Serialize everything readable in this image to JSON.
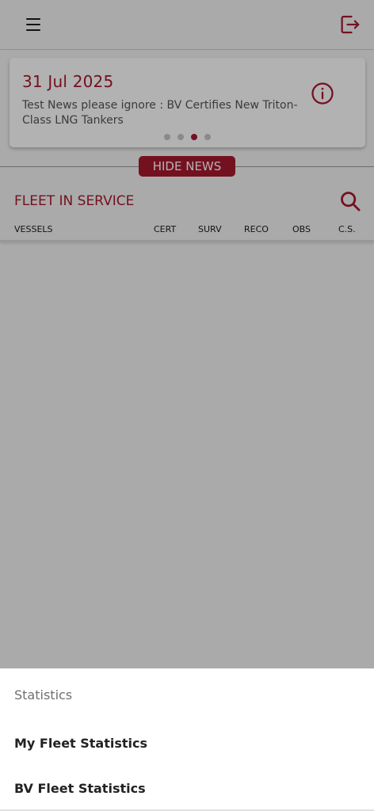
{
  "header": {
    "menu_icon": "hamburger-menu-icon",
    "logout_icon": "logout-icon"
  },
  "news": {
    "date": "31 Jul 2025",
    "text": "Test News please ignore : BV Certifies New Triton-Class LNG Tankers",
    "info_icon": "info-circle-icon",
    "pagination": {
      "total": 4,
      "active": 3
    },
    "hide_label": "HIDE NEWS"
  },
  "fleet": {
    "title": "FLEET IN SERVICE",
    "search_icon": "search-icon",
    "columns": [
      "VESSELS",
      "CERT",
      "SURV",
      "RECO",
      "OBS",
      "C.S."
    ]
  },
  "sheet": {
    "title": "Statistics",
    "items": [
      "My Fleet Statistics",
      "BV Fleet Statistics"
    ]
  },
  "colors": {
    "brand": "#a6192e"
  }
}
